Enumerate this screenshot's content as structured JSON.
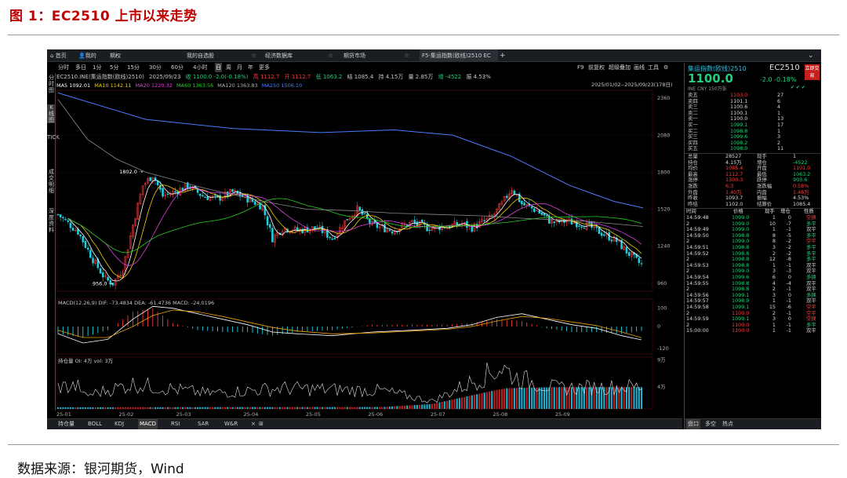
{
  "figure": {
    "title": "图 1：EC2510 上市以来走势",
    "source": "数据来源：银河期货，Wind"
  },
  "tabbar": {
    "home": "首页",
    "mine": "我的",
    "options": "期权",
    "watchlist": "我的自选股",
    "economic_db": "经济数据库",
    "futures_market": "期货市场",
    "active_tab": "F5-集运指数(欧线)2510 EC",
    "add": "+",
    "collapse": "⌄"
  },
  "toolbar": {
    "periods": [
      "分时",
      "多日",
      "1分",
      "5分",
      "15分",
      "30分",
      "60分",
      "4小时",
      "日",
      "周",
      "月",
      "年",
      "更多"
    ],
    "selected_period": "日",
    "right_tools": [
      "F9",
      "前复权",
      "超级叠加",
      "画线",
      "工具",
      "⚙"
    ]
  },
  "leftnav": {
    "items": [
      "分时图",
      "K线图",
      "TICK",
      "成交明细",
      "深度资料"
    ]
  },
  "infobar": {
    "contract": "EC2510.INE(集运指数(欧线)2510)",
    "date": "2025/09/23",
    "close": "收 1100.0",
    "change": "-2.0(-0.18%)",
    "high": "高 1112.7",
    "open": "开 1112.7",
    "low": "低 1063.2",
    "settle": "结 1085.4",
    "oi": "持 4.15万",
    "vol": "量 2.85万",
    "oichg": "增 -4522",
    "amp": "振 4.53%",
    "range": "2025/01/02--2025/09/23(178日)"
  },
  "mabar": {
    "ma5": "MA5 1092.01",
    "ma10": "MA10 1142.11",
    "ma20": "MA20 1220.32",
    "ma60": "MA60 1363.56",
    "ma120": "MA120 1363.83",
    "ma250": "MA250 1506.10"
  },
  "macd_label": {
    "name": "MACD(12,26,9)",
    "dif": "DIF: -73.4834",
    "dea": "DEA: -61.4736",
    "macd": "MACD: -24.0196"
  },
  "vol_label": {
    "name": "持仓量",
    "oi": "OI: 4万",
    "vol": "vol: 3万"
  },
  "bottom_tabs": [
    "持仓量",
    "BOLL",
    "KDJ",
    "MACD",
    "RSI",
    "SAR",
    "W&R",
    "×",
    "⊞"
  ],
  "right_panel": {
    "name": "集运指数(欧线)2510",
    "code": "EC2510",
    "badge": "立即交易",
    "price": "1100.0",
    "change": "-2.0",
    "pct": "-0.18%",
    "sub": "INE  CNY  150万张",
    "icons": "✔ ✔ ✔",
    "orderbook": [
      {
        "label": "卖五",
        "price": "1103.0",
        "vol": "27"
      },
      {
        "label": "卖四",
        "price": "1101.1",
        "vol": "6"
      },
      {
        "label": "卖三",
        "price": "1100.6",
        "vol": "4"
      },
      {
        "label": "卖二",
        "price": "1100.1",
        "vol": "1"
      },
      {
        "label": "卖一",
        "price": "1100.0",
        "vol": "13"
      },
      {
        "label": "买一",
        "price": "1099.1",
        "vol": "17"
      },
      {
        "label": "买二",
        "price": "1098.8",
        "vol": "1"
      },
      {
        "label": "买三",
        "price": "1099.6",
        "vol": "3"
      },
      {
        "label": "买四",
        "price": "1098.2",
        "vol": "2"
      },
      {
        "label": "买五",
        "price": "1098.0",
        "vol": "11"
      }
    ],
    "stats": [
      {
        "l1": "总量",
        "v1": "28527",
        "l2": "现手",
        "v2": "1"
      },
      {
        "l1": "持仓",
        "v1": "4.15万",
        "l2": "增仓",
        "v2": "-4522"
      },
      {
        "l1": "均价",
        "v1": "1085.4",
        "l2": "开盘",
        "v2": "1101.0"
      },
      {
        "l1": "最高",
        "v1": "1112.7",
        "l2": "最低",
        "v2": "1063.2"
      },
      {
        "l1": "涨停",
        "v1": "1300.3",
        "l2": "跌停",
        "v2": "903.6"
      },
      {
        "l1": "涨跌",
        "v1": "6.3",
        "l2": "涨跌幅",
        "v2": "0.58%"
      },
      {
        "l1": "外盘",
        "v1": "1.40万",
        "l2": "内盘",
        "v2": "1.46万"
      },
      {
        "l1": "昨收",
        "v1": "1093.7",
        "l2": "振幅",
        "v2": "4.53%"
      },
      {
        "l1": "昨结",
        "v1": "1102.0",
        "l2": "结算价",
        "v2": "1085.4"
      }
    ],
    "trade_header": [
      "时间",
      "价格",
      "现手",
      "增仓",
      "性质"
    ],
    "trades": [
      {
        "t": "14:59:48",
        "p": "1099.0",
        "v": "1",
        "c": "0",
        "n": "空换"
      },
      {
        "t": "2",
        "p": "1099.0",
        "v": "10",
        "c": "-7",
        "n": "多平"
      },
      {
        "t": "14:59:49",
        "p": "1099.0",
        "v": "1",
        "c": "-1",
        "n": "双平"
      },
      {
        "t": "14:59:50",
        "p": "1098.8",
        "v": "8",
        "c": "-5",
        "n": "多平"
      },
      {
        "t": "2",
        "p": "1099.0",
        "v": "8",
        "c": "-2",
        "n": "空平"
      },
      {
        "t": "14:59:51",
        "p": "1098.8",
        "v": "3",
        "c": "-2",
        "n": "多平"
      },
      {
        "t": "14:59:52",
        "p": "1098.8",
        "v": "2",
        "c": "-2",
        "n": "多平"
      },
      {
        "t": "2",
        "p": "1098.8",
        "v": "12",
        "c": "-8",
        "n": "多平"
      },
      {
        "t": "14:59:53",
        "p": "1098.8",
        "v": "1",
        "c": "-1",
        "n": "双平"
      },
      {
        "t": "2",
        "p": "1099.0",
        "v": "3",
        "c": "-3",
        "n": "双平"
      },
      {
        "t": "14:59:54",
        "p": "1099.6",
        "v": "6",
        "c": "0",
        "n": "多换"
      },
      {
        "t": "14:59:55",
        "p": "1098.8",
        "v": "4",
        "c": "-4",
        "n": "双平"
      },
      {
        "t": "2",
        "p": "1098.8",
        "v": "2",
        "c": "-1",
        "n": "双平"
      },
      {
        "t": "14:59:56",
        "p": "1099.1",
        "v": "3",
        "c": "0",
        "n": "多换"
      },
      {
        "t": "14:59:57",
        "p": "1098.9",
        "v": "1",
        "c": "-1",
        "n": "双平"
      },
      {
        "t": "14:59:58",
        "p": "1099.1",
        "v": "15",
        "c": "-6",
        "n": "空平"
      },
      {
        "t": "2",
        "p": "1100.0",
        "v": "2",
        "c": "-1",
        "n": "空平"
      },
      {
        "t": "14:59:59",
        "p": "1099.1",
        "v": "3",
        "c": "0",
        "n": "空换"
      },
      {
        "t": "2",
        "p": "1100.0",
        "v": "1",
        "c": "-1",
        "n": "多平"
      },
      {
        "t": "15:00:00",
        "p": "1100.0",
        "v": "1",
        "c": "-1",
        "n": "双平"
      }
    ],
    "bottom_tabs": [
      "盘口",
      "多空",
      "热点"
    ]
  },
  "chart_data": [
    {
      "type": "candlestick",
      "title": "EC2510.INE(集运指数(欧线)2510) 日K",
      "y_ticks": [
        960,
        1240,
        1520,
        1800,
        2080,
        2360
      ],
      "ylim": [
        900,
        2420
      ],
      "x_ticks": [
        "25-01",
        "25-02",
        "25-03",
        "25-04",
        "25-05",
        "25-06",
        "25-07",
        "25-08",
        "25-09"
      ],
      "annotations": [
        {
          "text": "1802.0",
          "value": 1802
        },
        {
          "text": "956.0",
          "value": 956
        }
      ],
      "keypoints": [
        [
          0,
          1480
        ],
        [
          8,
          1350
        ],
        [
          14,
          1140
        ],
        [
          19,
          990
        ],
        [
          22,
          960
        ],
        [
          26,
          1070
        ],
        [
          30,
          1400
        ],
        [
          34,
          1700
        ],
        [
          38,
          1780
        ],
        [
          42,
          1620
        ],
        [
          48,
          1660
        ],
        [
          52,
          1700
        ],
        [
          58,
          1620
        ],
        [
          64,
          1600
        ],
        [
          70,
          1650
        ],
        [
          76,
          1600
        ],
        [
          82,
          1540
        ],
        [
          86,
          1300
        ],
        [
          90,
          1380
        ],
        [
          96,
          1360
        ],
        [
          104,
          1380
        ],
        [
          110,
          1300
        ],
        [
          116,
          1450
        ],
        [
          120,
          1520
        ],
        [
          126,
          1400
        ],
        [
          134,
          1360
        ],
        [
          142,
          1420
        ],
        [
          148,
          1380
        ],
        [
          156,
          1390
        ],
        [
          162,
          1410
        ],
        [
          166,
          1380
        ],
        [
          174,
          1460
        ],
        [
          178,
          1560
        ],
        [
          182,
          1680
        ],
        [
          186,
          1560
        ],
        [
          192,
          1510
        ],
        [
          198,
          1420
        ],
        [
          204,
          1430
        ],
        [
          212,
          1400
        ],
        [
          218,
          1340
        ],
        [
          224,
          1280
        ],
        [
          228,
          1200
        ],
        [
          232,
          1130
        ],
        [
          234,
          1100
        ]
      ],
      "ma250": [
        [
          0,
          2400
        ],
        [
          60,
          2200
        ],
        [
          120,
          2130
        ],
        [
          180,
          2100
        ],
        [
          230,
          2120
        ],
        [
          270,
          2080
        ],
        [
          310,
          1920
        ],
        [
          350,
          1700
        ],
        [
          380,
          1580
        ],
        [
          400,
          1530
        ]
      ],
      "ma120": [
        [
          0,
          2350
        ],
        [
          20,
          2050
        ],
        [
          40,
          1900
        ],
        [
          60,
          1800
        ],
        [
          100,
          1680
        ],
        [
          140,
          1580
        ],
        [
          170,
          1520
        ],
        [
          200,
          1510
        ],
        [
          230,
          1490
        ],
        [
          260,
          1480
        ],
        [
          290,
          1470
        ],
        [
          320,
          1450
        ],
        [
          360,
          1430
        ],
        [
          400,
          1390
        ]
      ]
    },
    {
      "type": "line",
      "name": "MACD(12,26,9)",
      "y_ticks": [
        100,
        0,
        -120
      ],
      "ylim": [
        -150,
        150
      ],
      "dif": [
        [
          0,
          -40
        ],
        [
          10,
          -90
        ],
        [
          20,
          -70
        ],
        [
          30,
          40
        ],
        [
          38,
          110
        ],
        [
          46,
          100
        ],
        [
          56,
          70
        ],
        [
          66,
          40
        ],
        [
          76,
          10
        ],
        [
          86,
          -30
        ],
        [
          96,
          -40
        ],
        [
          110,
          -50
        ],
        [
          126,
          -30
        ],
        [
          142,
          -20
        ],
        [
          156,
          -10
        ],
        [
          166,
          10
        ],
        [
          176,
          50
        ],
        [
          186,
          70
        ],
        [
          196,
          40
        ],
        [
          206,
          10
        ],
        [
          216,
          -10
        ],
        [
          226,
          -50
        ],
        [
          234,
          -73
        ]
      ],
      "dea": [
        [
          0,
          -20
        ],
        [
          10,
          -60
        ],
        [
          20,
          -60
        ],
        [
          30,
          0
        ],
        [
          38,
          60
        ],
        [
          46,
          90
        ],
        [
          56,
          80
        ],
        [
          66,
          55
        ],
        [
          76,
          25
        ],
        [
          86,
          -5
        ],
        [
          96,
          -25
        ],
        [
          110,
          -40
        ],
        [
          126,
          -35
        ],
        [
          142,
          -25
        ],
        [
          156,
          -15
        ],
        [
          166,
          0
        ],
        [
          176,
          30
        ],
        [
          186,
          55
        ],
        [
          196,
          45
        ],
        [
          206,
          25
        ],
        [
          216,
          5
        ],
        [
          226,
          -30
        ],
        [
          234,
          -61
        ]
      ]
    },
    {
      "type": "bar",
      "name": "持仓量",
      "y_ticks": [
        "9万",
        "4万"
      ],
      "oi_open_day": 130,
      "oi": [
        [
          0,
          0.3
        ],
        [
          130,
          0.35
        ],
        [
          150,
          0.9
        ],
        [
          175,
          3.4
        ],
        [
          180,
          3.8
        ],
        [
          200,
          4.0
        ],
        [
          234,
          4.0
        ]
      ],
      "vol_peaks": [
        [
          10,
          2.5
        ],
        [
          30,
          4.8
        ],
        [
          60,
          3.0
        ],
        [
          90,
          4.0
        ],
        [
          130,
          3.5
        ],
        [
          150,
          1.5
        ],
        [
          178,
          8.0
        ],
        [
          184,
          6.0
        ],
        [
          200,
          4.0
        ],
        [
          230,
          4.3
        ]
      ]
    }
  ]
}
